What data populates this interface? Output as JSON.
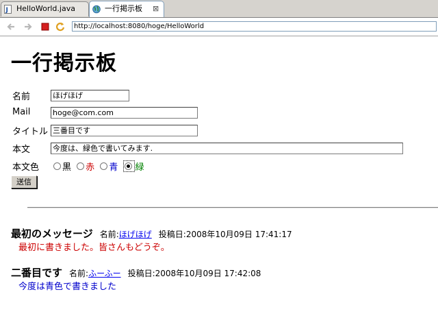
{
  "tabs": {
    "java_file": "HelloWorld.java",
    "board": "一行掲示板"
  },
  "browser": {
    "url": "http://localhost:8080/hoge/HelloWorld"
  },
  "page": {
    "title": "一行掲示板",
    "form": {
      "name_label": "名前",
      "name_value": "ほげほげ",
      "mail_label": "Mail",
      "mail_value": "hoge@com.com",
      "title_label": "タイトル",
      "title_value": "三番目です",
      "body_label": "本文",
      "body_value": "今度は、緑色で書いてみます.",
      "color_label": "本文色",
      "colors": [
        {
          "label": "黒",
          "color": "#000000",
          "checked": false
        },
        {
          "label": "赤",
          "color": "#cc0000",
          "checked": false
        },
        {
          "label": "青",
          "color": "#0000cc",
          "checked": false
        },
        {
          "label": "緑",
          "color": "#008000",
          "checked": true
        }
      ],
      "submit_label": "送信"
    },
    "posts": [
      {
        "title": "最初のメッセージ",
        "name_prefix": "名前:",
        "name": "ほげほげ",
        "date_prefix": "投稿日:",
        "date": "2008年10月09日 17:41:17",
        "body": "最初に書きました。皆さんもどうぞ。",
        "body_color": "#cc0000"
      },
      {
        "title": "二番目です",
        "name_prefix": "名前:",
        "name": "ふーふー",
        "date_prefix": "投稿日:",
        "date": "2008年10月09日 17:42:08",
        "body": "今度は青色で書きました",
        "body_color": "#0000cc"
      }
    ]
  }
}
